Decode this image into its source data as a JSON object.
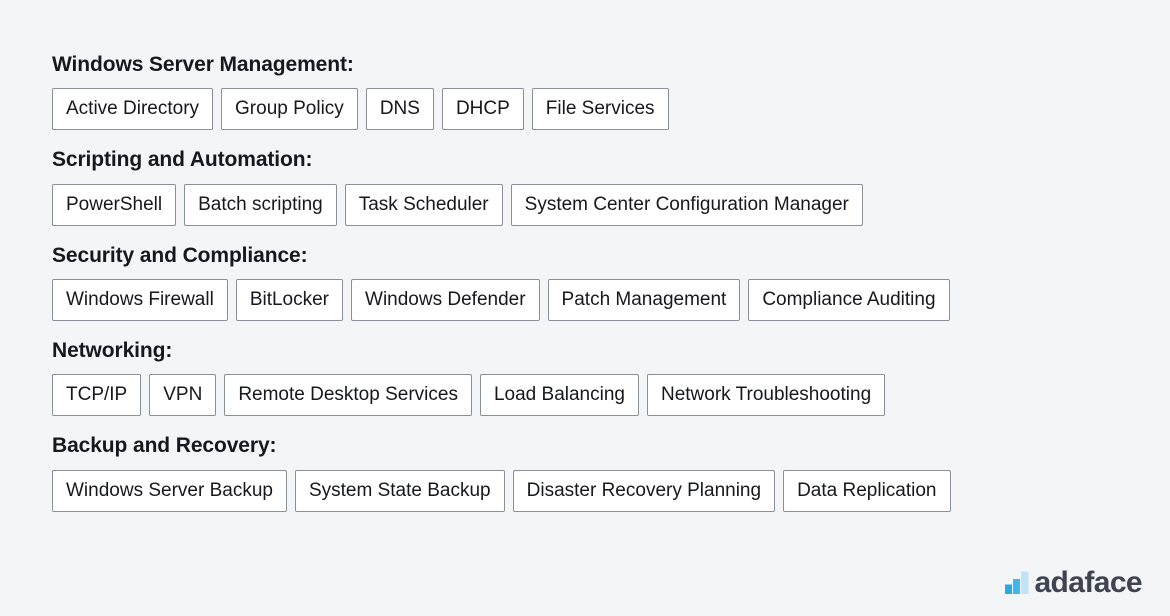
{
  "page": {
    "background_color": "#f4f5f7",
    "text_color": "#16181d",
    "tag_border_color": "#8a8f98",
    "tag_background_color": "#ffffff"
  },
  "sections": [
    {
      "heading": "Windows Server Management:",
      "tags": [
        "Active Directory",
        "Group Policy",
        "DNS",
        "DHCP",
        "File Services"
      ]
    },
    {
      "heading": "Scripting and Automation:",
      "tags": [
        "PowerShell",
        "Batch scripting",
        "Task Scheduler",
        "System Center Configuration Manager"
      ]
    },
    {
      "heading": "Security and Compliance:",
      "tags": [
        "Windows Firewall",
        "BitLocker",
        "Windows Defender",
        "Patch Management",
        "Compliance Auditing"
      ]
    },
    {
      "heading": "Networking:",
      "tags": [
        "TCP/IP",
        "VPN",
        "Remote Desktop Services",
        "Load Balancing",
        "Network Troubleshooting"
      ]
    },
    {
      "heading": "Backup and Recovery:",
      "tags": [
        "Windows Server Backup",
        "System State Backup",
        "Disaster Recovery Planning",
        "Data Replication"
      ]
    }
  ],
  "logo": {
    "icon": "bar-chart-icon",
    "text": "adaface",
    "text_color": "#3f4451",
    "bar_colors": [
      "#29abe2",
      "#3fb8f0",
      "#bfe3f7"
    ]
  }
}
